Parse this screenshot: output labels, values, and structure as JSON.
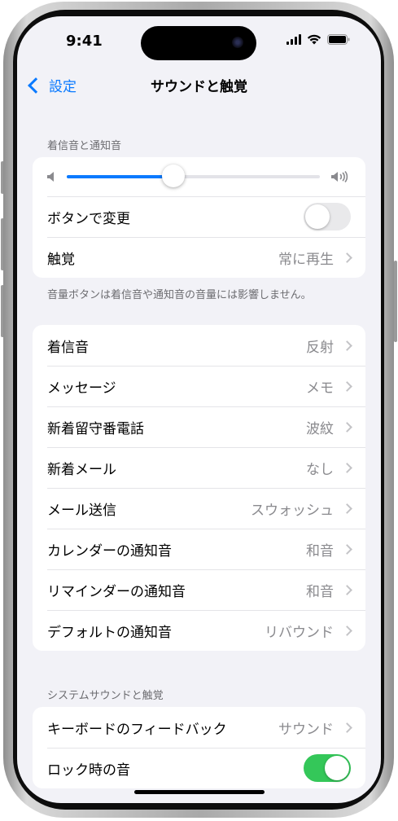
{
  "status": {
    "time": "9:41"
  },
  "nav": {
    "back_label": "設定",
    "title": "サウンドと触覚"
  },
  "ringer_section": {
    "header": "着信音と通知音",
    "volume": 0.42,
    "rows": [
      {
        "label": "ボタンで変更",
        "toggle": false
      },
      {
        "label": "触覚",
        "value": "常に再生"
      }
    ],
    "footer": "音量ボタンは着信音や通知音の音量には影響しません。"
  },
  "tones_section": {
    "rows": [
      {
        "label": "着信音",
        "value": "反射"
      },
      {
        "label": "メッセージ",
        "value": "メモ"
      },
      {
        "label": "新着留守番電話",
        "value": "波紋"
      },
      {
        "label": "新着メール",
        "value": "なし"
      },
      {
        "label": "メール送信",
        "value": "スウォッシュ"
      },
      {
        "label": "カレンダーの通知音",
        "value": "和音"
      },
      {
        "label": "リマインダーの通知音",
        "value": "和音"
      },
      {
        "label": "デフォルトの通知音",
        "value": "リバウンド"
      }
    ]
  },
  "system_section": {
    "header": "システムサウンドと触覚",
    "rows": [
      {
        "label": "キーボードのフィードバック",
        "value": "サウンド"
      },
      {
        "label": "ロック時の音",
        "toggle": true
      }
    ]
  },
  "colors": {
    "accent": "#0a7aff",
    "toggle_on": "#34c759",
    "toggle_off": "#e9e9eb",
    "background": "#f2f2f7"
  },
  "icons": [
    "chevron-left-icon",
    "signal-icon",
    "wifi-icon",
    "battery-icon",
    "speaker-low-icon",
    "speaker-high-icon",
    "chevron-right-icon"
  ]
}
